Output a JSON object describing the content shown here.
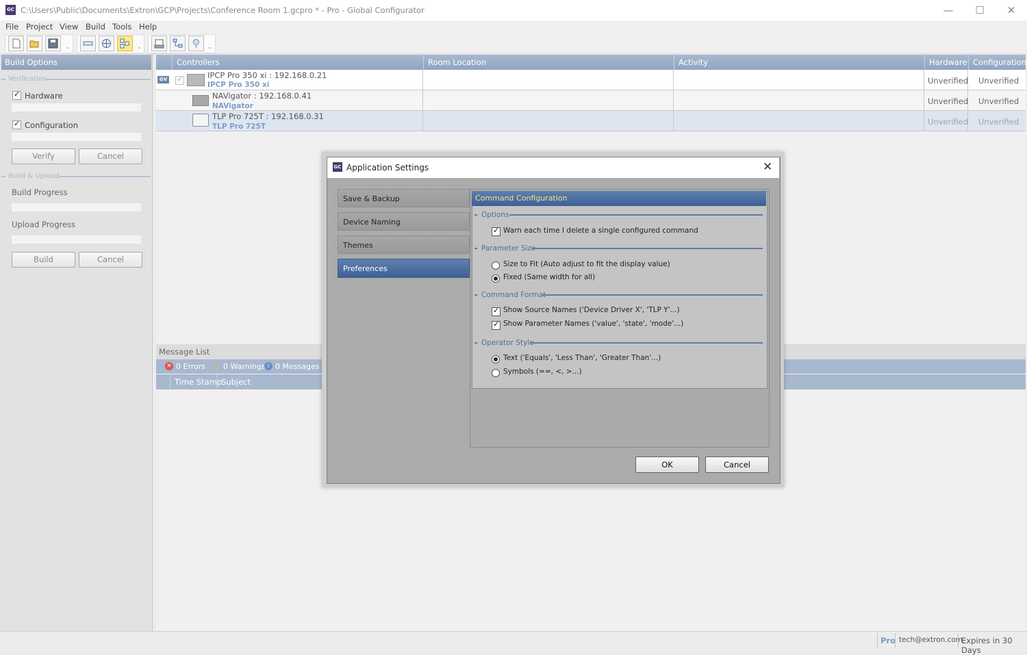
{
  "window": {
    "icon_text": "GC",
    "title": "C:\\Users\\Public\\Documents\\Extron\\GCP\\Projects\\Conference Room 1.gcpro * - Pro - Global Configurator",
    "minimize": "—",
    "maximize": "☐",
    "close": "✕"
  },
  "menu": [
    "File",
    "Project",
    "View",
    "Build",
    "Tools",
    "Help"
  ],
  "toolbar": {
    "icons": [
      "new-file-icon",
      "open-folder-icon",
      "save-icon",
      "room-icon",
      "globe-icon",
      "layout-icon",
      "report-icon",
      "network-icon",
      "map-pin-icon"
    ],
    "overflow": "⌄"
  },
  "build_options": {
    "header": "Build Options",
    "verification_label": "Verification",
    "hardware_label": "Hardware",
    "configuration_label": "Configuration",
    "verify_button": "Verify",
    "cancel_button": "Cancel",
    "build_upload_label": "Build & Upload",
    "build_progress_label": "Build Progress",
    "upload_progress_label": "Upload Progress",
    "build_button": "Build",
    "cancel_button_2": "Cancel"
  },
  "grid": {
    "columns": [
      "Controllers",
      "Room Location",
      "Activity",
      "Hardware",
      "Configuration"
    ],
    "rows": [
      {
        "name": "IPCP Pro 350 xi : 192.168.0.21",
        "model": "IPCP Pro 350 xi",
        "badge": "GV",
        "hardware": "Unverified",
        "configuration": "Unverified"
      },
      {
        "name": "NAVigator : 192.168.0.41",
        "model": "NAVigator",
        "hardware": "Unverified",
        "configuration": "Unverified"
      },
      {
        "name": "TLP Pro 725T : 192.168.0.31",
        "model": "TLP Pro 725T",
        "hardware": "Unverified",
        "configuration": "Unverified"
      }
    ]
  },
  "message_list": {
    "title": "Message List",
    "errors": "0 Errors",
    "warnings": "0 Warnings",
    "messages": "0 Messages",
    "col_timestamp": "Time Stamp",
    "col_subject": "Subject"
  },
  "status_bar": {
    "edition": "Pro",
    "email": "tech@extron.com",
    "expires": "Expires in 30 Days"
  },
  "dialog": {
    "icon_text": "GC",
    "title": "Application Settings",
    "close": "✕",
    "nav": [
      "Save & Backup",
      "Device Naming",
      "Themes",
      "Preferences"
    ],
    "active_nav": "Preferences",
    "content_header": "Command Configuration",
    "options_label": "Options",
    "warn_delete": "Warn each time I delete a single configured command",
    "parameter_size_label": "Parameter Size",
    "size_to_fit": "Size to Fit (Auto adjust to fit the display value)",
    "fixed": "Fixed (Same width for all)",
    "command_format_label": "Command Format",
    "show_source_names": "Show Source Names ('Device Driver X', 'TLP Y'...)",
    "show_parameter_names": "Show Parameter Names ('value', 'state', 'mode'...)",
    "operator_style_label": "Operator Style",
    "text_style": "Text ('Equals', 'Less Than', 'Greater Than'...)",
    "symbols_style": "Symbols (==, <, >...)",
    "ok_button": "OK",
    "cancel_button": "Cancel"
  },
  "colors": {
    "header_blue": "#92a5c0",
    "dialog_accent": "#3e6097",
    "dialog_header_text": "#f3e58a"
  }
}
